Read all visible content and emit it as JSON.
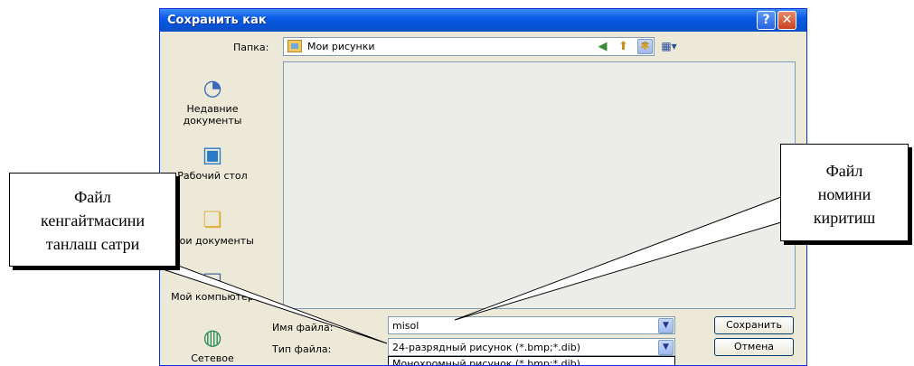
{
  "window": {
    "title": "Сохранить как",
    "help_label": "?",
    "close_label": "✕"
  },
  "toolbar": {
    "folder_label": "Папка:",
    "folder_value": "Мои рисунки",
    "folder_icon": "pictures-folder-icon",
    "back_icon": "back-arrow-icon",
    "up_icon": "up-folder-icon",
    "new_folder_icon": "new-folder-icon",
    "views_icon": "views-menu-icon"
  },
  "places": [
    {
      "label": "Недавние документы",
      "icon": "recent-documents-icon"
    },
    {
      "label": "Рабочий стол",
      "icon": "desktop-icon"
    },
    {
      "label": "Мои документы",
      "icon": "my-documents-icon"
    },
    {
      "label": "Мой компьютер",
      "icon": "my-computer-icon"
    },
    {
      "label": "Сетевое",
      "icon": "network-icon"
    }
  ],
  "form": {
    "filename_label": "Имя файла:",
    "filename_value": "misol",
    "filetype_label": "Тип файла:",
    "filetype_value": "24-разрядный рисунок (*.bmp;*.dib)",
    "filetype_option_next": "Монохромный рисунок (*.bmp;*.dib)",
    "save_label": "Сохранить",
    "cancel_label": "Отмена"
  },
  "callouts": {
    "extension": [
      "Файл",
      "кенгайтмасини",
      "танлаш сатри"
    ],
    "filename": [
      "Файл",
      "номини",
      "киритиш"
    ]
  },
  "colors": {
    "title_bar": "#0a5ae6",
    "dialog_bg": "#ece9d8",
    "list_bg": "#ecece8"
  }
}
